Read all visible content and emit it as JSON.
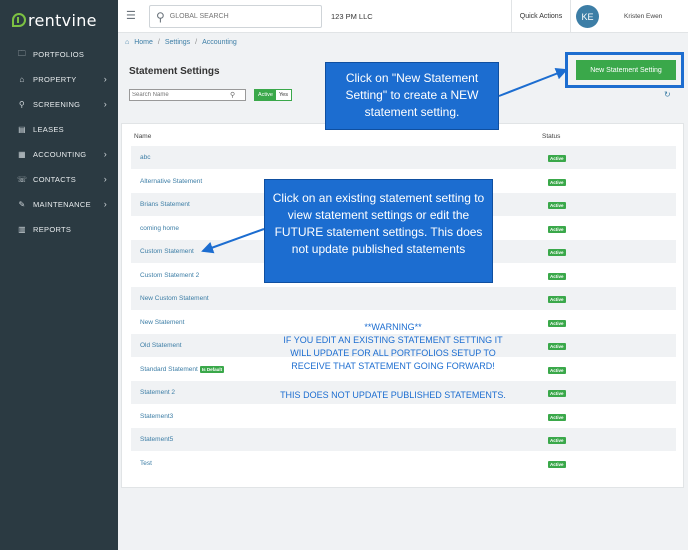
{
  "brand": {
    "name": "rentvine"
  },
  "sidebar": {
    "items": [
      {
        "label": "PORTFOLIOS",
        "icon": "folder-icon",
        "glyph": "🗀",
        "chevron": false
      },
      {
        "label": "PROPERTY",
        "icon": "home-icon",
        "glyph": "⌂",
        "chevron": true
      },
      {
        "label": "SCREENING",
        "icon": "search-icon",
        "glyph": "⚲",
        "chevron": true
      },
      {
        "label": "LEASES",
        "icon": "document-icon",
        "glyph": "▤",
        "chevron": false
      },
      {
        "label": "ACCOUNTING",
        "icon": "ledger-icon",
        "glyph": "▦",
        "chevron": true
      },
      {
        "label": "CONTACTS",
        "icon": "contacts-icon",
        "glyph": "☏",
        "chevron": true
      },
      {
        "label": "MAINTENANCE",
        "icon": "wrench-icon",
        "glyph": "✎",
        "chevron": true
      },
      {
        "label": "REPORTS",
        "icon": "chart-icon",
        "glyph": "▥",
        "chevron": false
      }
    ],
    "chevron_glyph": "›"
  },
  "topbar": {
    "search_placeholder": "GLOBAL SEARCH",
    "company": "123 PM LLC",
    "quick_actions": "Quick Actions",
    "avatar_initials": "KE",
    "user_name": "Kristen Ewen"
  },
  "breadcrumb": {
    "home": "Home",
    "settings": "Settings",
    "accounting": "Accounting",
    "separator": "/"
  },
  "page": {
    "title": "Statement Settings",
    "new_button": "New Statement Setting",
    "search_placeholder": "Search Name",
    "toggle_on": "Active",
    "toggle_off": "Yes"
  },
  "table": {
    "columns": {
      "name": "Name",
      "status": "Status"
    },
    "rows": [
      {
        "name": "abc",
        "status": "Active",
        "default": ""
      },
      {
        "name": "Alternative Statement",
        "status": "Active",
        "default": ""
      },
      {
        "name": "Brians Statement",
        "status": "Active",
        "default": ""
      },
      {
        "name": "coming home",
        "status": "Active",
        "default": ""
      },
      {
        "name": "Custom Statement",
        "status": "Active",
        "default": ""
      },
      {
        "name": "Custom Statement 2",
        "status": "Active",
        "default": ""
      },
      {
        "name": "New Custom Statement",
        "status": "Active",
        "default": ""
      },
      {
        "name": "New Statement",
        "status": "Active",
        "default": ""
      },
      {
        "name": "Old Statement",
        "status": "Active",
        "default": ""
      },
      {
        "name": "Standard Statement",
        "status": "Active",
        "default": "Is Default"
      },
      {
        "name": "Statement 2",
        "status": "Active",
        "default": ""
      },
      {
        "name": "Statement3",
        "status": "Active",
        "default": ""
      },
      {
        "name": "Statement5",
        "status": "Active",
        "default": ""
      },
      {
        "name": "Test",
        "status": "Active",
        "default": ""
      }
    ]
  },
  "annotations": {
    "callout_new": "Click on \"New Statement Setting\" to create a NEW statement setting.",
    "callout_existing": "Click on an existing statement setting to view statement settings or edit the FUTURE statement settings. This does not update published statements",
    "warning_lines": [
      "**WARNING**",
      "IF YOU EDIT AN EXISTING STATEMENT SETTING IT",
      "WILL UPDATE FOR ALL PORTFOLIOS SETUP TO",
      "RECEIVE THAT STATEMENT GOING FORWARD!"
    ],
    "note": "THIS DOES NOT UPDATE PUBLISHED STATEMENTS."
  },
  "colors": {
    "sidebar": "#2b3a42",
    "accent_green": "#3aa84a",
    "link_blue": "#3d7ea6",
    "annotation_blue": "#1c6dd0"
  }
}
